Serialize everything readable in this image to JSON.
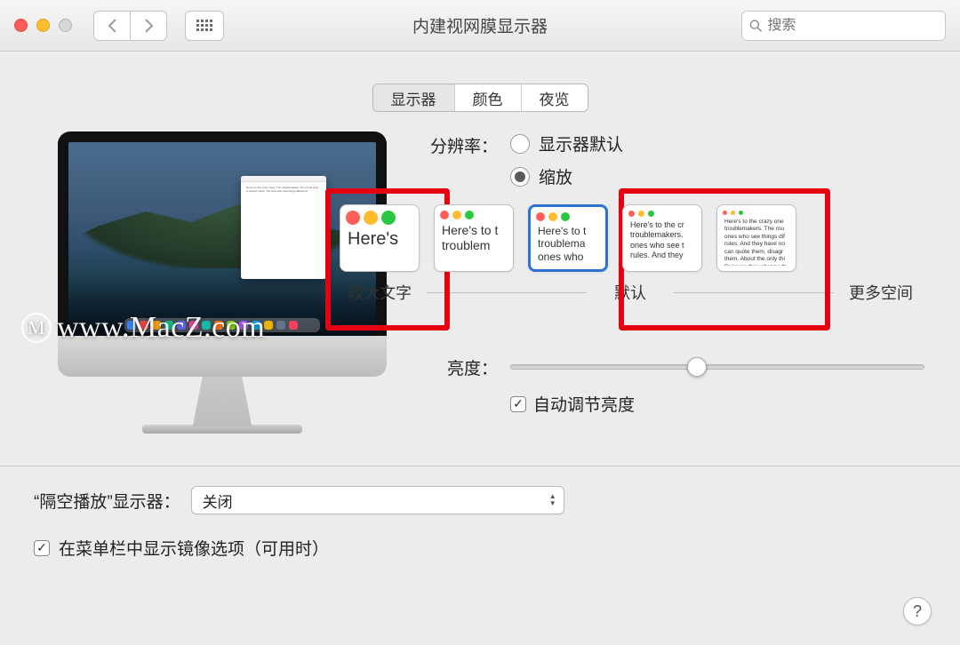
{
  "window": {
    "title": "内建视网膜显示器"
  },
  "search": {
    "placeholder": "搜索"
  },
  "tabs": {
    "display": "显示器",
    "color": "颜色",
    "night": "夜览",
    "active": "display"
  },
  "resolution": {
    "label": "分辨率：",
    "options": {
      "default": "显示器默认",
      "scaled": "缩放"
    },
    "selected": "scaled"
  },
  "scale_options": [
    {
      "id": "larger",
      "preview": "Here's"
    },
    {
      "id": "mid1",
      "preview": "Here's to t troublem"
    },
    {
      "id": "default",
      "preview": "Here's to t troublema ones who"
    },
    {
      "id": "mid2",
      "preview": "Here's to the cr troublemakers. ones who see t rules. And they"
    },
    {
      "id": "more",
      "preview": "Here's to the crazy one troublemakers. The rou ones who see things dif rules. And they have no can quote them, disagr them. About the only thi Because they change th"
    }
  ],
  "scale_captions": {
    "larger": "较大文字",
    "default": "默认",
    "more": "更多空间"
  },
  "scale_selected": "default",
  "brightness": {
    "label": "亮度：",
    "value": 45,
    "auto_label": "自动调节亮度",
    "auto_checked": true
  },
  "airplay": {
    "label": "“隔空播放”显示器：",
    "value": "关闭"
  },
  "mirror": {
    "label": "在菜单栏中显示镜像选项（可用时）",
    "checked": true
  },
  "watermark": "www.MacZ.com",
  "dock_colors": [
    "#3b82f6",
    "#ef4444",
    "#f59e0b",
    "#10b981",
    "#6366f1",
    "#ec4899",
    "#14b8a6",
    "#f97316",
    "#84cc16",
    "#a855f7",
    "#0ea5e9",
    "#eab308",
    "#64748b",
    "#f43f5e"
  ]
}
